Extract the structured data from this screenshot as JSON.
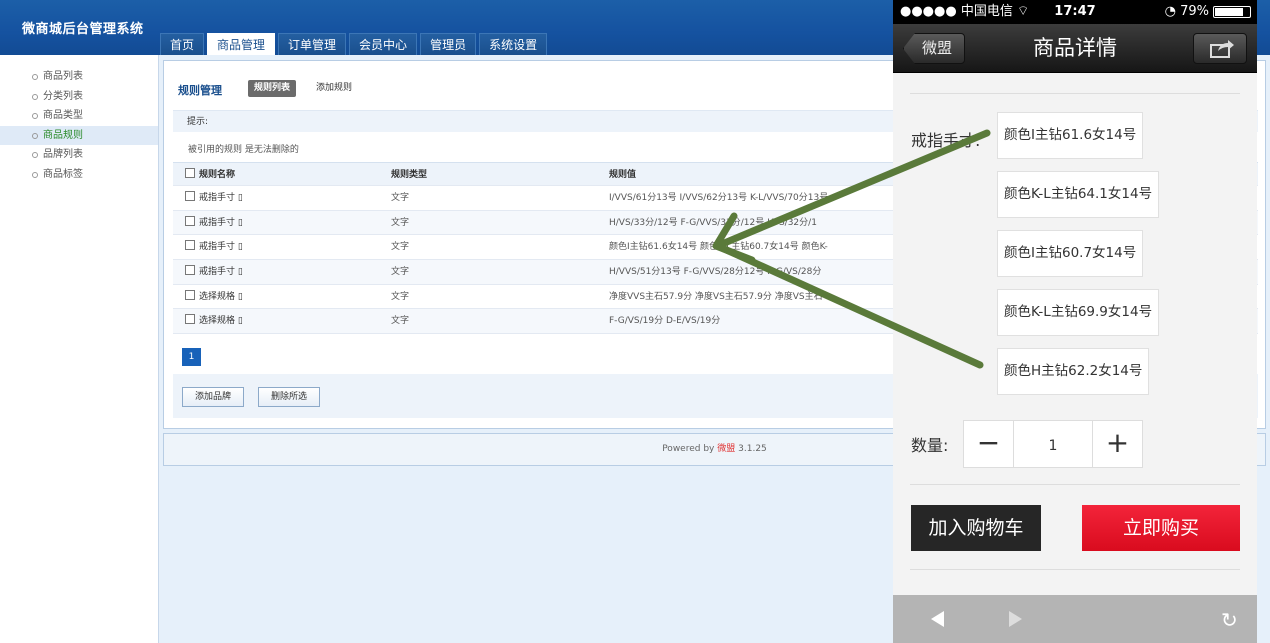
{
  "admin": {
    "brand": "微商城后台管理系统",
    "nav_tabs": [
      {
        "label": "首页",
        "active": false
      },
      {
        "label": "商品管理",
        "active": true
      },
      {
        "label": "订单管理",
        "active": false
      },
      {
        "label": "会员中心",
        "active": false
      },
      {
        "label": "管理员",
        "active": false
      },
      {
        "label": "系统设置",
        "active": false
      }
    ],
    "left_menu": [
      {
        "label": "商品列表",
        "active": false
      },
      {
        "label": "分类列表",
        "active": false
      },
      {
        "label": "商品类型",
        "active": false
      },
      {
        "label": "商品规则",
        "active": true
      },
      {
        "label": "品牌列表",
        "active": false
      },
      {
        "label": "商品标签",
        "active": false
      }
    ],
    "panel_title": "规则管理",
    "sub_tabs": {
      "active": "规则列表",
      "other": "添加规则"
    },
    "tip_label": "提示:",
    "tip_text": "被引用的规则 是无法删除的",
    "table": {
      "headers": [
        "规则名称",
        "规则类型",
        "规则值"
      ],
      "rows": [
        {
          "name": "戒指手寸 ▯",
          "type": "文字",
          "value": "I/VVS/61分13号  I/VVS/62分13号  K-L/VVS/70分13号"
        },
        {
          "name": "戒指手寸 ▯",
          "type": "文字",
          "value": "H/VS/33分/12号  F-G/VVS/33分/12号  I/VS/32分/1"
        },
        {
          "name": "戒指手寸 ▯",
          "type": "文字",
          "value": "颜色I主钻61.6女14号  颜色K-L主钻60.7女14号  颜色K-"
        },
        {
          "name": "戒指手寸 ▯",
          "type": "文字",
          "value": "H/VVS/51分13号  F-G/VVS/28分12号  F-G/VS/28分"
        },
        {
          "name": "选择规格 ▯",
          "type": "文字",
          "value": "净度VVS主石57.9分  净度VS主石57.9分  净度VS主石"
        },
        {
          "name": "选择规格 ▯",
          "type": "文字",
          "value": "F-G/VS/19分  D-E/VS/19分"
        }
      ]
    },
    "page_number": "1",
    "buttons": {
      "add": "添加品牌",
      "delete": "删除所选"
    },
    "footer": {
      "powered_by": "Powered by",
      "brand": "微盟",
      "version": "3.1.25"
    }
  },
  "phone": {
    "status": {
      "carrier": "●●●●● 中国电信 ⌔",
      "time": "17:47",
      "battery": "◔ 79%"
    },
    "back_label": "微盟",
    "title": "商品详情",
    "ring_label": "戒指手寸:",
    "options": [
      "颜色I主钻61.6女14号",
      "颜色K-L主钻64.1女14号",
      "颜色I主钻60.7女14号",
      "颜色K-L主钻69.9女14号",
      "颜色H主钻62.2女14号"
    ],
    "qty_label": "数量:",
    "qty_value": "1",
    "minus": "−",
    "plus": "+",
    "add_to_cart": "加入购物车",
    "buy_now": "立即购买",
    "colors": {
      "buy": "#e8101f",
      "cart": "#262626",
      "arrow": "#5a7a3a"
    }
  }
}
